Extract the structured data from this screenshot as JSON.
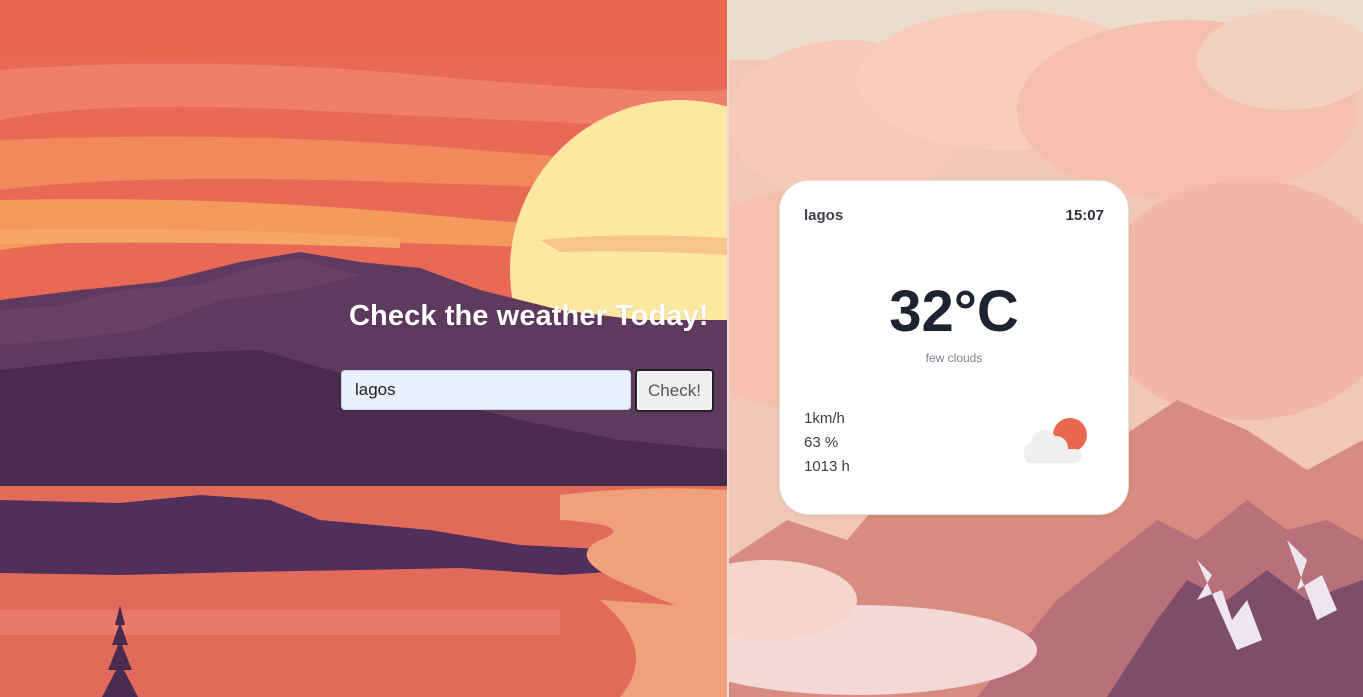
{
  "search": {
    "heading": "Check the weather Today!",
    "input_value": "lagos",
    "button_label": "Check!"
  },
  "card": {
    "city": "lagos",
    "time": "15:07",
    "temperature": "32°C",
    "description": "few clouds",
    "wind": "1km/h",
    "humidity": "63 %",
    "pressure": "1013 h",
    "icon": "few-clouds-day-icon"
  },
  "colors": {
    "sunset_sky": "#e86a56",
    "sun": "#fde8a1",
    "mountain": "#5e3a5f",
    "sun_icon": "#e8674e",
    "cloud_icon": "#efefef"
  }
}
